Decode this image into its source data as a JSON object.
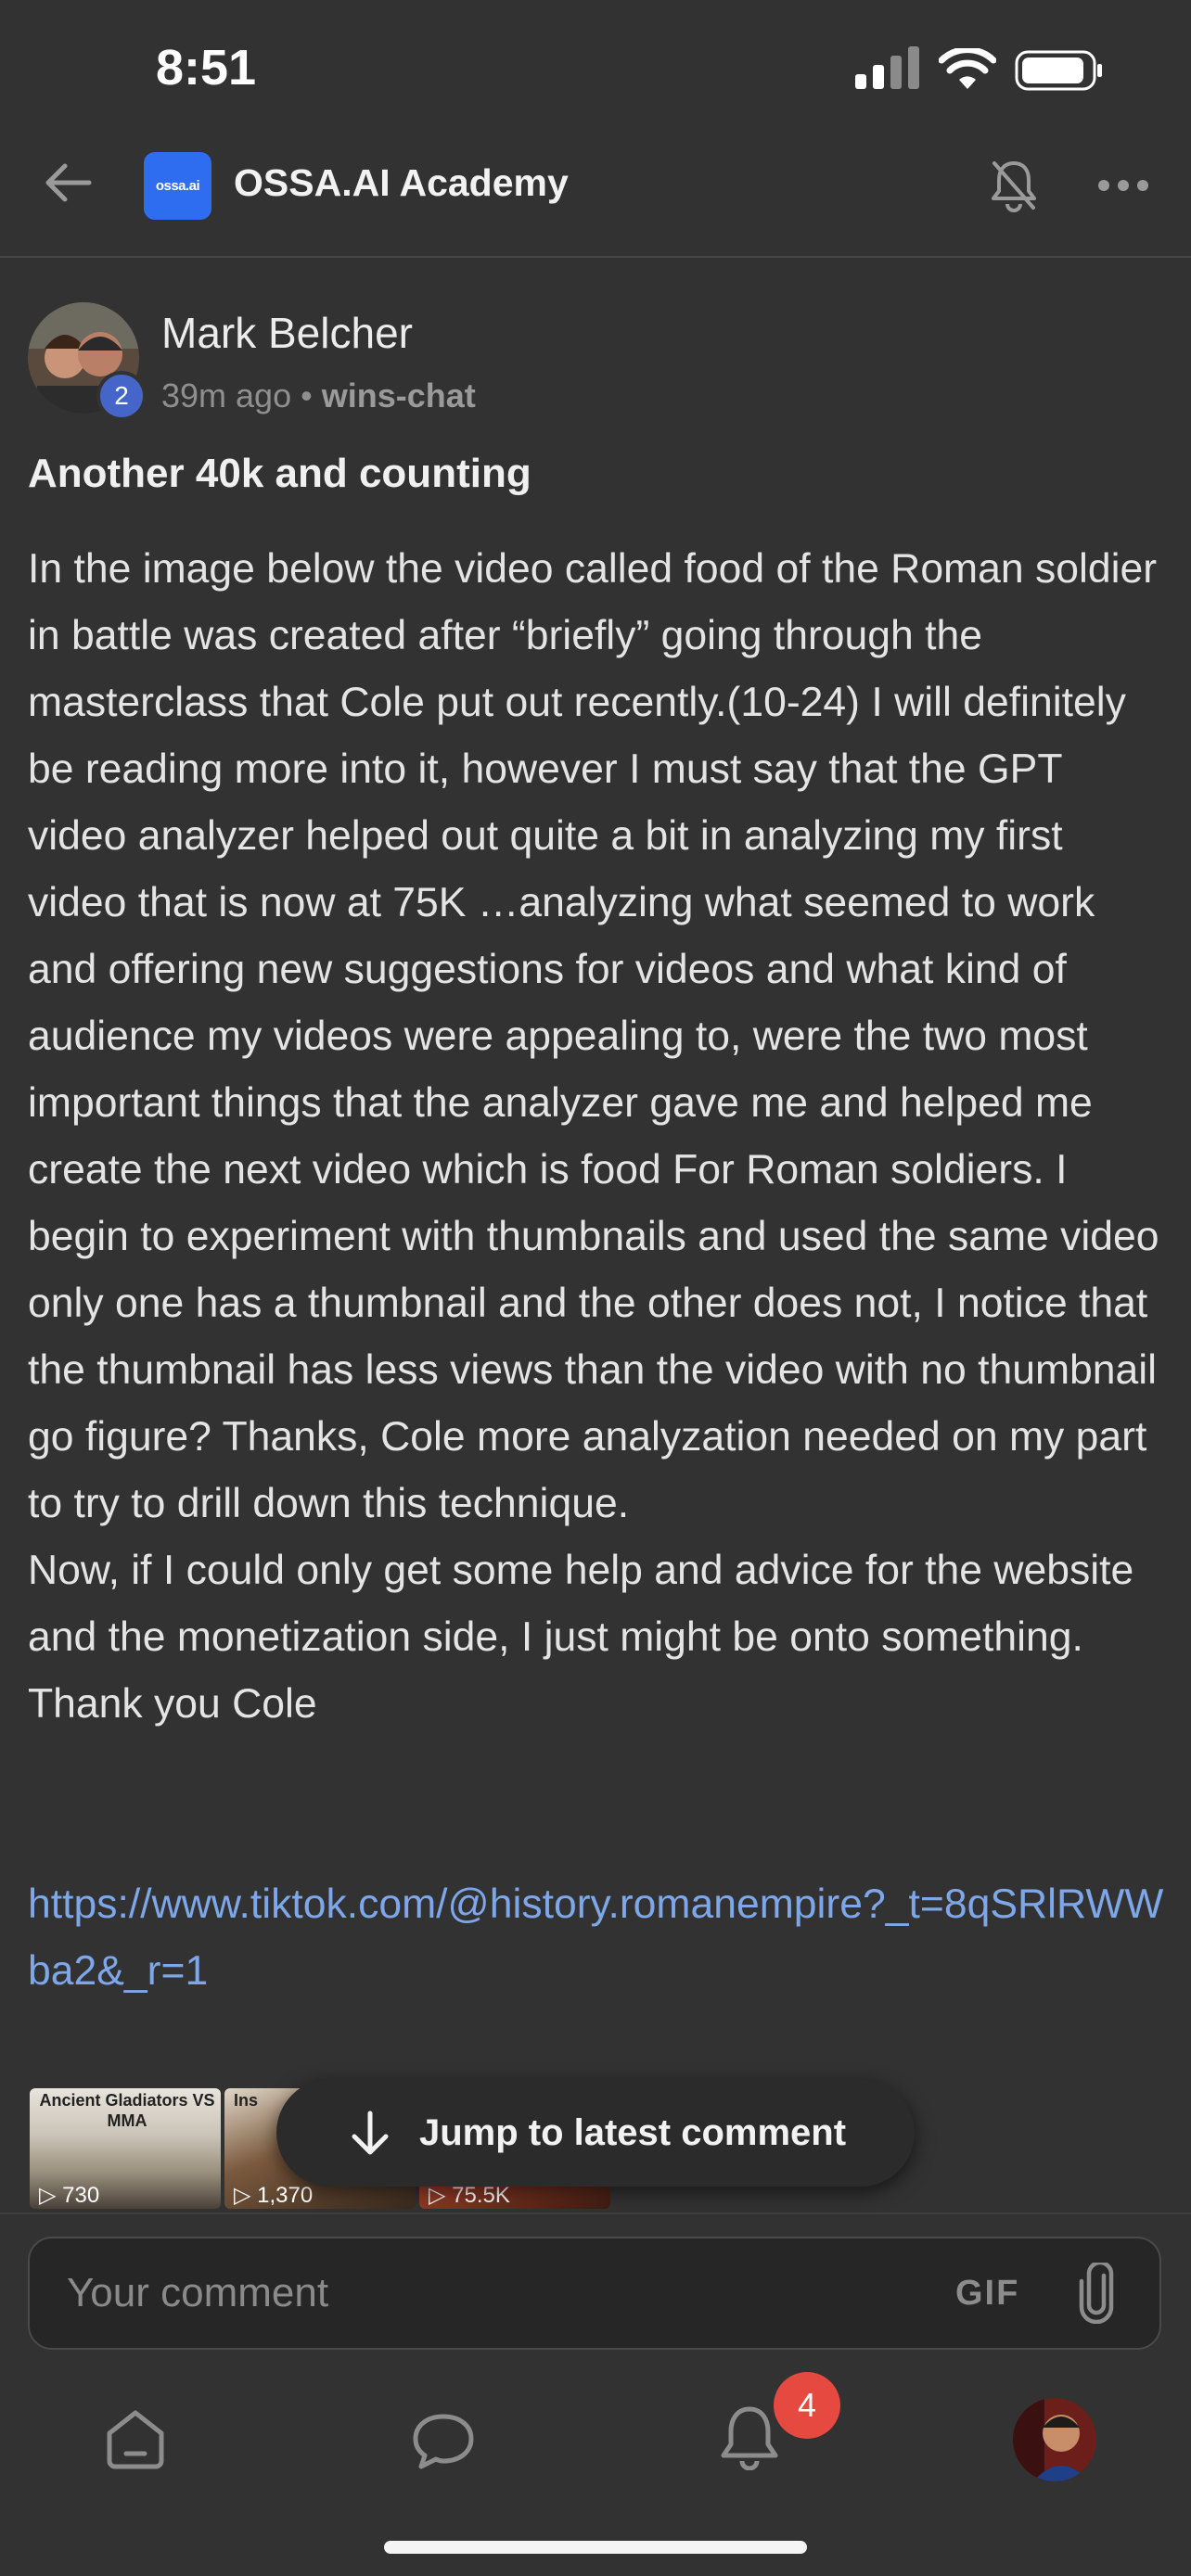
{
  "status_bar": {
    "time": "8:51"
  },
  "header": {
    "logo_text": "ossa.ai",
    "title": "OSSA.AI Academy"
  },
  "post": {
    "author": "Mark Belcher",
    "level": "2",
    "time_ago": "39m ago",
    "separator": "•",
    "channel": "wins-chat",
    "title": "Another 40k and counting",
    "body": "In the image below the video called food of the Roman soldier in battle was created after “briefly” going through the masterclass that Cole put out recently.(10-24) I will definitely be reading more into it, however I must say that the GPT video analyzer helped out quite a bit in analyzing my first video that is now at 75K …analyzing what seemed to work and offering new suggestions for videos and what kind of audience my videos were appealing to, were the two most important things that the analyzer gave me and helped me create the next video which is food For Roman soldiers. I begin to experiment with thumbnails and used the same video only one has a thumbnail and the other does not, I notice that the thumbnail has less views than the video with no thumbnail go figure? Thanks, Cole more analyzation needed on my part to try to drill down this technique.\nNow, if I could only get some help and advice for the website and the monetization side, I just might be onto something.\nThank you Cole",
    "link": "https://www.tiktok.com/@history.romanempire?_t=8qSRlRWWba2&_r=1",
    "thumbnails": [
      {
        "caption": "Ancient Gladiators VS MMA",
        "views": "▷ 730"
      },
      {
        "caption": "Ins",
        "views": "▷ 1,370"
      },
      {
        "caption": "",
        "views": "▷ 75.5K"
      }
    ]
  },
  "jump_button": {
    "label": "Jump to latest comment"
  },
  "comment_bar": {
    "placeholder": "Your comment",
    "gif_label": "GIF"
  },
  "tab_bar": {
    "notification_count": "4"
  },
  "icons": [
    "back-arrow-icon",
    "bell-off-icon",
    "more-icon",
    "arrow-down-icon",
    "paperclip-icon",
    "home-icon",
    "chat-icon",
    "bell-icon"
  ],
  "colors": {
    "background": "#323232",
    "link": "#7ea7ea",
    "logo": "#2f6df0",
    "badge": "#e5493f",
    "level_badge": "#4566c8"
  }
}
